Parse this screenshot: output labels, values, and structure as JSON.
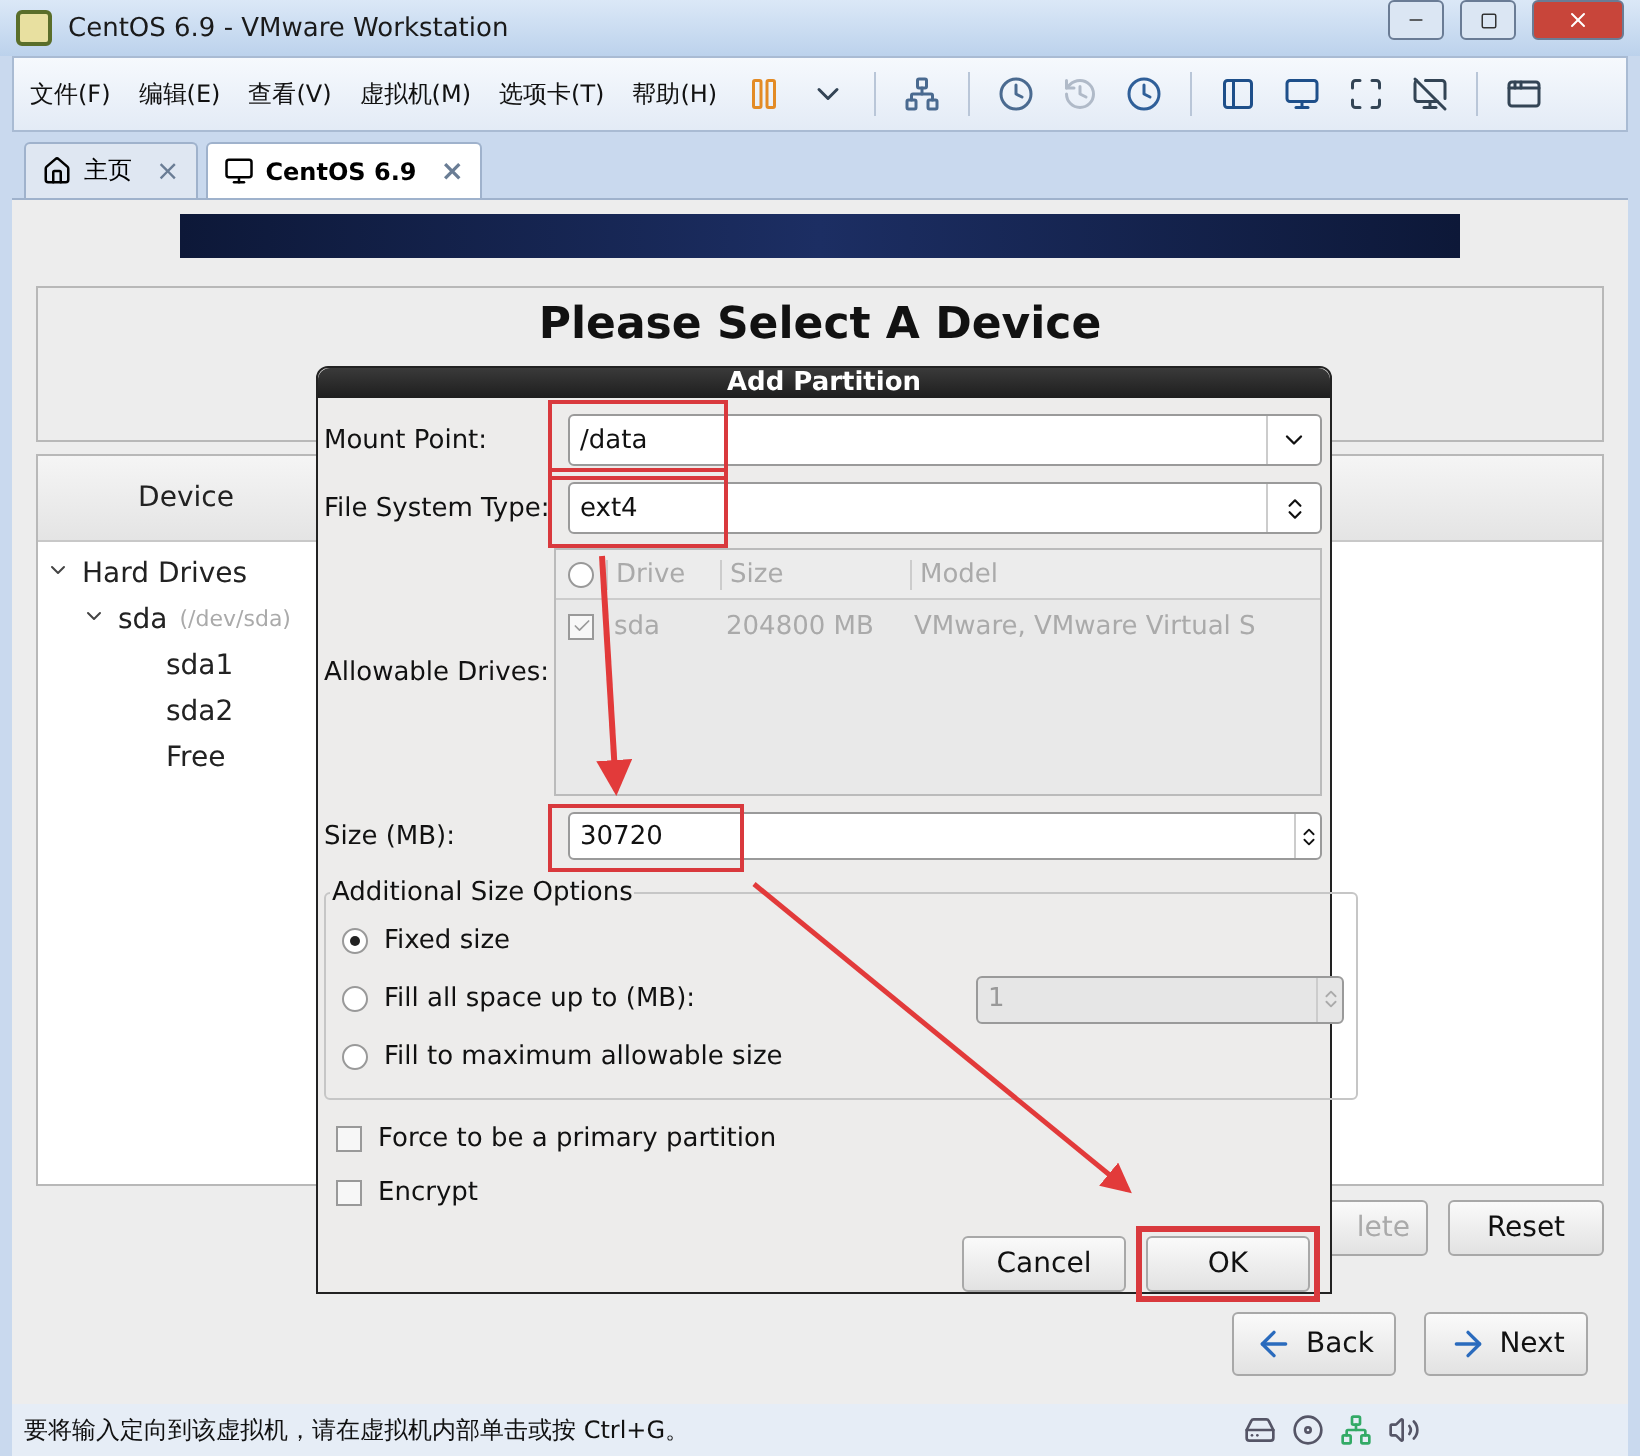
{
  "window": {
    "title": "CentOS 6.9 - VMware Workstation"
  },
  "menu": [
    {
      "label": "文件(F)"
    },
    {
      "label": "编辑(E)"
    },
    {
      "label": "查看(V)"
    },
    {
      "label": "虚拟机(M)"
    },
    {
      "label": "选项卡(T)"
    },
    {
      "label": "帮助(H)"
    }
  ],
  "tabs": [
    {
      "label": "主页",
      "kind": "home",
      "selected": false,
      "close": "×"
    },
    {
      "label": "CentOS 6.9",
      "kind": "vm",
      "selected": true,
      "close": "×"
    }
  ],
  "installer": {
    "heading": "Please Select A Device",
    "device_column": "Device",
    "tree": [
      {
        "label": "Hard Drives",
        "expanded": true,
        "children": [
          {
            "label": "sda",
            "detail": "(/dev/sda)",
            "expanded": true,
            "children": [
              {
                "label": "sda1"
              },
              {
                "label": "sda2"
              },
              {
                "label": "Free"
              }
            ]
          }
        ]
      }
    ],
    "buttons": [
      {
        "label": "lete",
        "disabled": true
      },
      {
        "label": "Reset",
        "disabled": false
      }
    ],
    "nav": [
      {
        "label": "Back",
        "kind": "back"
      },
      {
        "label": "Next",
        "kind": "next"
      }
    ]
  },
  "dialog": {
    "title": "Add Partition",
    "mount_point": {
      "label": "Mount Point:",
      "value": "/data",
      "highlighted": true
    },
    "file_system_type": {
      "label": "File System Type:",
      "value": "ext4",
      "highlighted": true
    },
    "allowable_drives": {
      "label": "Allowable Drives:",
      "columns": [
        "Drive",
        "Size",
        "Model"
      ],
      "rows": [
        {
          "checked": true,
          "drive": "sda",
          "size": "204800 MB",
          "model": "VMware, VMware Virtual S"
        }
      ]
    },
    "size": {
      "label": "Size (MB):",
      "value": "30720",
      "highlighted": true
    },
    "size_options": {
      "title": "Additional Size Options",
      "options": [
        {
          "label": "Fixed size",
          "selected": true
        },
        {
          "label": "Fill all space up to (MB):",
          "selected": false,
          "value": "1"
        },
        {
          "label": "Fill to maximum allowable size",
          "selected": false
        }
      ]
    },
    "checkboxes": [
      {
        "label": "Force to be a primary partition",
        "checked": false
      },
      {
        "label": "Encrypt",
        "checked": false
      }
    ],
    "buttons": [
      {
        "label": "Cancel",
        "highlighted": false
      },
      {
        "label": "OK",
        "highlighted": true
      }
    ]
  },
  "status_bar": {
    "text": "要将输入定向到该虚拟机，请在虚拟机内部单击或按 Ctrl+G。"
  }
}
